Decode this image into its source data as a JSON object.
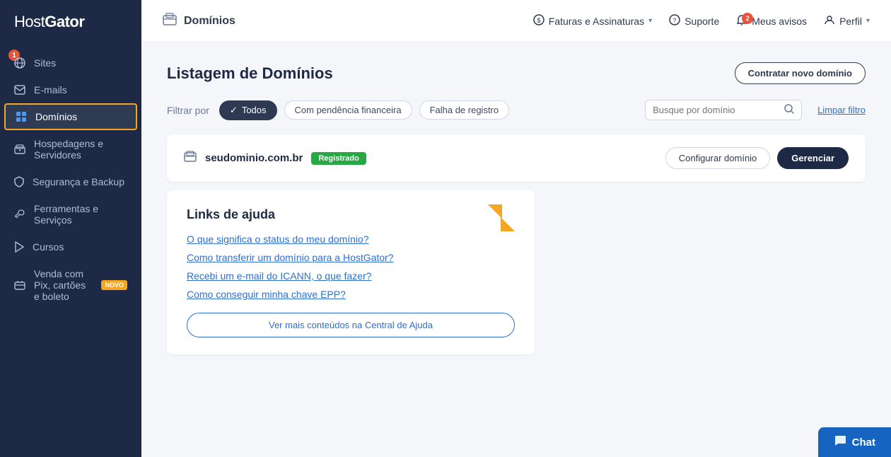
{
  "sidebar": {
    "logo": "HostGator",
    "badge": "1",
    "items": [
      {
        "id": "sites",
        "label": "Sites",
        "icon": "🌐"
      },
      {
        "id": "emails",
        "label": "E-mails",
        "icon": "✉️"
      },
      {
        "id": "dominios",
        "label": "Domínios",
        "icon": "⊞",
        "active": true
      },
      {
        "id": "hospedagens",
        "label": "Hospedagens e Servidores",
        "icon": "🖥️"
      },
      {
        "id": "seguranca",
        "label": "Segurança e Backup",
        "icon": "🔒"
      },
      {
        "id": "ferramentas",
        "label": "Ferramentas e Serviços",
        "icon": "🔧"
      },
      {
        "id": "cursos",
        "label": "Cursos",
        "icon": "▶️"
      },
      {
        "id": "venda",
        "label": "Venda com Pix, cartões e boleto",
        "icon": "💳",
        "badge": "NOVO"
      }
    ]
  },
  "header": {
    "title": "Domínios",
    "nav": [
      {
        "id": "faturas",
        "label": "Faturas e Assinaturas",
        "hasDropdown": true,
        "icon": "💲"
      },
      {
        "id": "suporte",
        "label": "Suporte",
        "icon": "❓"
      },
      {
        "id": "avisos",
        "label": "Meus avisos",
        "badge": "2",
        "icon": "🔔"
      },
      {
        "id": "perfil",
        "label": "Perfil",
        "hasDropdown": true,
        "icon": "👤"
      }
    ]
  },
  "content": {
    "title": "Listagem de Domínios",
    "new_domain_btn": "Contratar novo domínio",
    "filter_label": "Filtrar por",
    "filters": [
      {
        "id": "todos",
        "label": "Todos",
        "active": true
      },
      {
        "id": "pendencia",
        "label": "Com pendência financeira",
        "active": false
      },
      {
        "id": "falha",
        "label": "Falha de registro",
        "active": false
      }
    ],
    "search_placeholder": "Busque por domínio",
    "clear_filter": "Limpar filtro",
    "domain": {
      "name": "seudominio.com.br",
      "status": "Registrado",
      "config_btn": "Configurar domínio",
      "manage_btn": "Gerenciar"
    },
    "help": {
      "title": "Links de ajuda",
      "links": [
        "O que significa o status do meu domínio?",
        "Como transferir um domínio para a HostGator?",
        "Recebi um e-mail do ICANN, o que fazer?",
        "Como conseguir minha chave EPP?"
      ],
      "more_btn": "Ver mais conteúdos na Central de Ajuda"
    }
  },
  "chat": {
    "label": "Chat",
    "icon": "💬"
  }
}
